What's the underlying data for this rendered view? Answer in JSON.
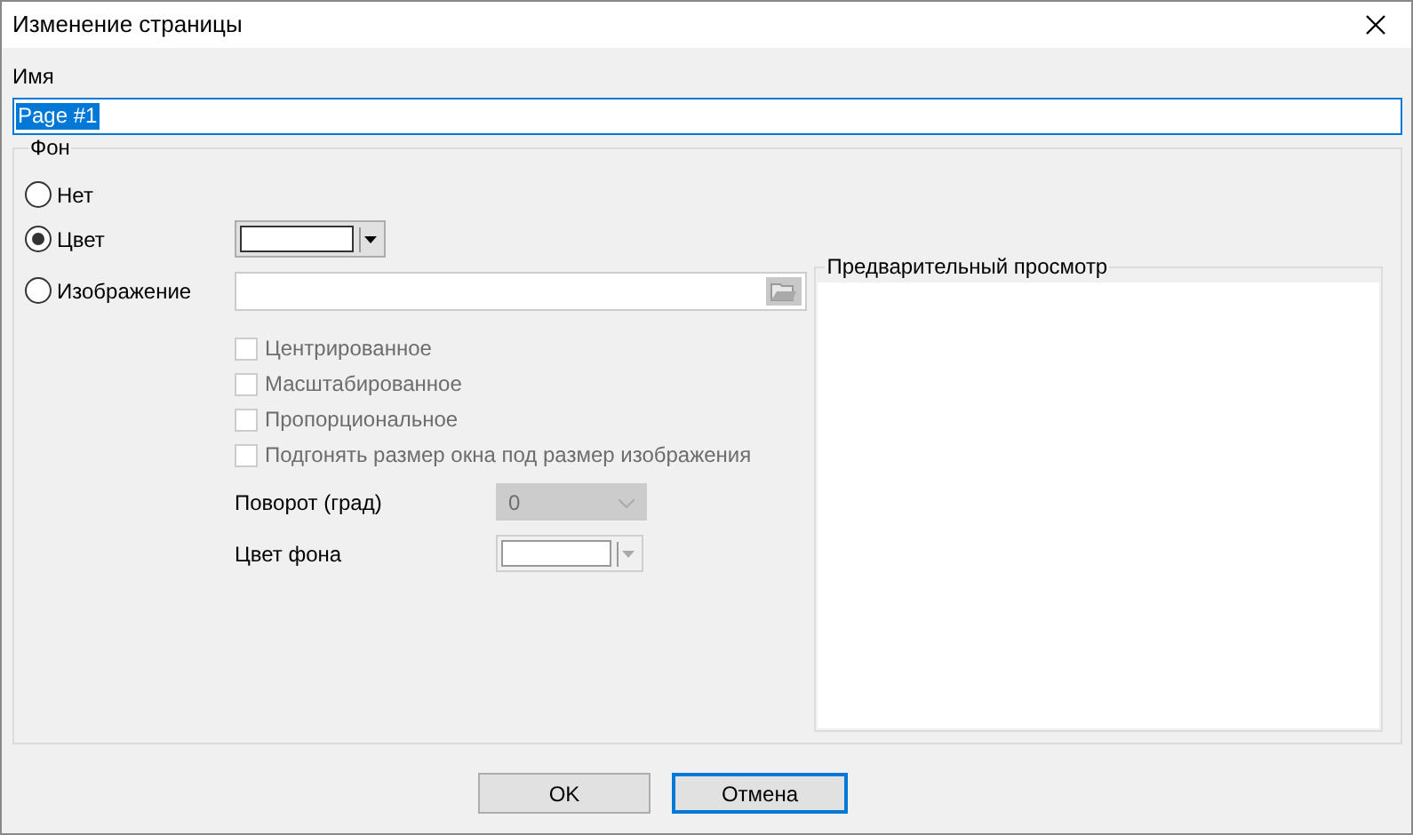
{
  "window": {
    "title": "Изменение страницы"
  },
  "name": {
    "label": "Имя",
    "value": "Page #1",
    "text_selected": true
  },
  "background": {
    "legend": "Фон",
    "options": [
      {
        "label": "Нет",
        "selected": false
      },
      {
        "label": "Цвет",
        "selected": true
      },
      {
        "label": "Изображение",
        "selected": false
      }
    ],
    "image_field": {
      "disabled": false
    },
    "checkboxes": [
      {
        "label": "Центрированное",
        "checked": false,
        "disabled": true
      },
      {
        "label": "Масштабированное",
        "checked": false,
        "disabled": true
      },
      {
        "label": "Пропорциональное",
        "checked": false,
        "disabled": true
      },
      {
        "label": "Подгонять размер окна под размер изображения",
        "checked": false,
        "disabled": true
      }
    ],
    "rotation": {
      "label": "Поворот (град)",
      "value": "0",
      "disabled": true
    },
    "bg_color": {
      "label": "Цвет фона",
      "disabled": true
    },
    "preview": {
      "legend": "Предварительный просмотр"
    }
  },
  "buttons": [
    {
      "label": "OK",
      "focused": false
    },
    {
      "label": "Отмена",
      "focused": true
    }
  ]
}
